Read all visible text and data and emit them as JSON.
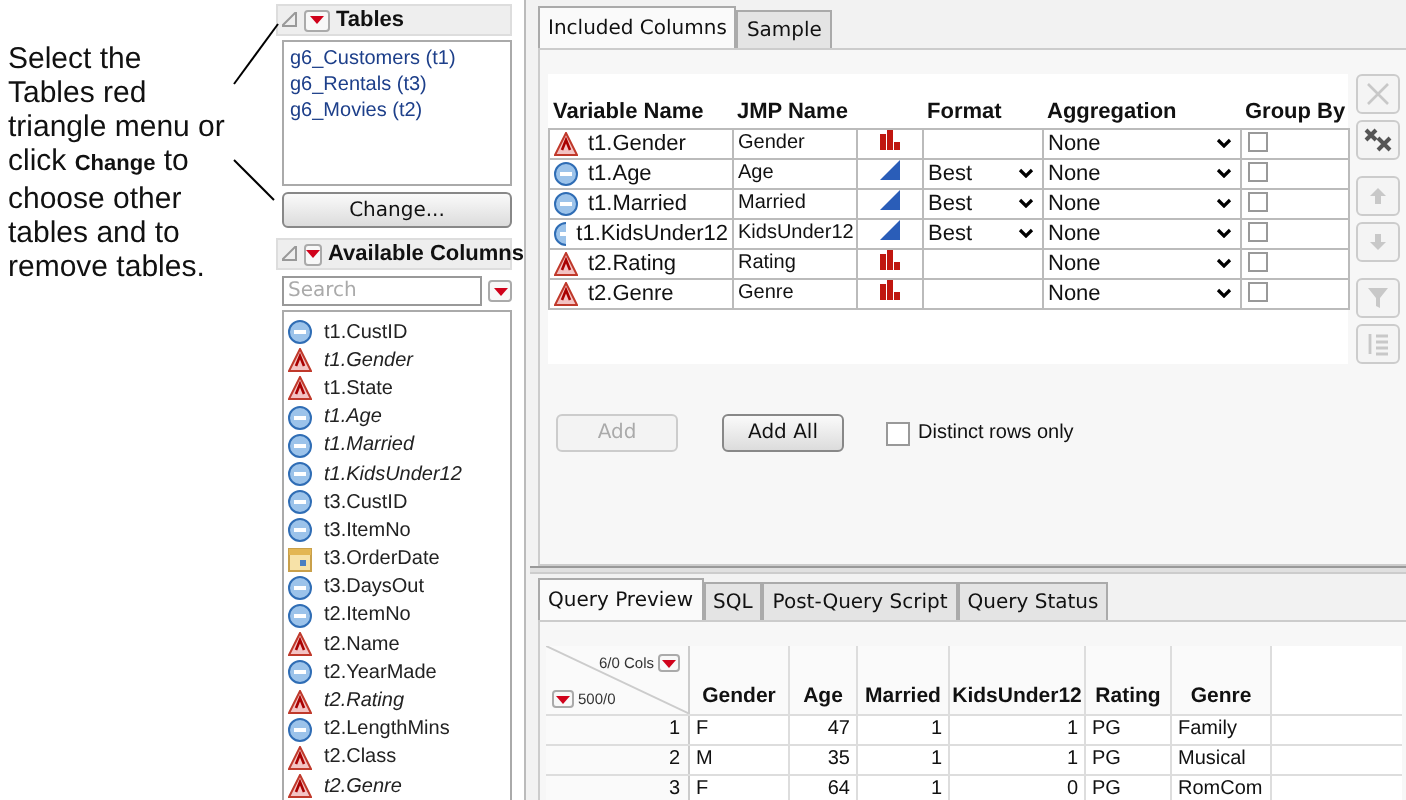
{
  "annotation": "Select the Tables red triangle menu or click **Change** to choose other tables and to remove tables.",
  "tables": {
    "title": "Tables",
    "items": [
      "g6_Customers (t1)",
      "g6_Rentals (t3)",
      "g6_Movies (t2)"
    ],
    "button": "Change..."
  },
  "available_columns": {
    "title": "Available Columns",
    "search": {
      "placeholder": "Search"
    },
    "items": [
      {
        "name": "t1.CustID",
        "kind": "numeric",
        "included": false
      },
      {
        "name": "t1.Gender",
        "kind": "character",
        "included": true
      },
      {
        "name": "t1.State",
        "kind": "character",
        "included": false
      },
      {
        "name": "t1.Age",
        "kind": "numeric",
        "included": true
      },
      {
        "name": "t1.Married",
        "kind": "numeric",
        "included": true
      },
      {
        "name": "t1.KidsUnder12",
        "kind": "numeric",
        "included": true
      },
      {
        "name": "t3.CustID",
        "kind": "numeric",
        "included": false
      },
      {
        "name": "t3.ItemNo",
        "kind": "numeric",
        "included": false
      },
      {
        "name": "t3.OrderDate",
        "kind": "date",
        "included": false
      },
      {
        "name": "t3.DaysOut",
        "kind": "numeric",
        "included": false
      },
      {
        "name": "t2.ItemNo",
        "kind": "numeric",
        "included": false
      },
      {
        "name": "t2.Name",
        "kind": "character",
        "included": false
      },
      {
        "name": "t2.YearMade",
        "kind": "numeric",
        "included": false
      },
      {
        "name": "t2.Rating",
        "kind": "character",
        "included": true
      },
      {
        "name": "t2.LengthMins",
        "kind": "numeric",
        "included": false
      },
      {
        "name": "t2.Class",
        "kind": "character",
        "included": false
      },
      {
        "name": "t2.Genre",
        "kind": "character",
        "included": true
      }
    ]
  },
  "included_tabs": [
    {
      "label": "Included Columns",
      "selected": true
    },
    {
      "label": "Sample",
      "selected": false
    }
  ],
  "included_columns": {
    "headers": {
      "variable": "Variable Name",
      "jmp_name": "JMP Name",
      "format": "Format",
      "aggregation": "Aggregation",
      "group_by": "Group By"
    },
    "rows": [
      {
        "variable": "t1.Gender",
        "kind": "character",
        "jmp_name": "Gender",
        "modeling": {
          "kind": "nominal"
        },
        "aggregation": "None",
        "group_by": false
      },
      {
        "variable": "t1.Age",
        "kind": "numeric",
        "jmp_name": "Age",
        "modeling": {
          "kind": "continuous"
        },
        "format": "Best",
        "aggregation": "None",
        "group_by": false
      },
      {
        "variable": "t1.Married",
        "kind": "numeric",
        "jmp_name": "Married",
        "modeling": {
          "kind": "continuous"
        },
        "format": "Best",
        "aggregation": "None",
        "group_by": false
      },
      {
        "variable": "t1.KidsUnder12",
        "kind": "numeric",
        "jmp_name": "KidsUnder12",
        "modeling": {
          "kind": "continuous"
        },
        "format": "Best",
        "aggregation": "None",
        "group_by": false
      },
      {
        "variable": "t2.Rating",
        "kind": "character",
        "jmp_name": "Rating",
        "modeling": {
          "kind": "nominal"
        },
        "aggregation": "None",
        "group_by": false
      },
      {
        "variable": "t2.Genre",
        "kind": "character",
        "jmp_name": "Genre",
        "modeling": {
          "kind": "nominal"
        },
        "aggregation": "None",
        "group_by": false
      }
    ]
  },
  "side_tools": [
    {
      "kind": "remove",
      "disabled": true
    },
    {
      "kind": "remove_all",
      "disabled": false
    },
    {
      "kind": "up",
      "disabled": true
    },
    {
      "kind": "down",
      "disabled": true
    },
    {
      "kind": "filter",
      "disabled": true
    },
    {
      "kind": "sort",
      "disabled": true
    }
  ],
  "actions": {
    "add": {
      "label": "Add",
      "disabled": true
    },
    "add_all": {
      "label": "Add All",
      "disabled": false
    },
    "distinct": {
      "label": "Distinct rows only",
      "checked": false
    }
  },
  "preview_tabs": [
    {
      "label": "Query Preview",
      "selected": true
    },
    {
      "label": "SQL",
      "selected": false
    },
    {
      "label": "Post-Query Script",
      "selected": false
    },
    {
      "label": "Query Status",
      "selected": false
    }
  ],
  "preview": {
    "cols_label": "6/0 Cols",
    "rows_label": "500/0",
    "columns": [
      {
        "name": "Gender",
        "kind": "character"
      },
      {
        "name": "Age",
        "kind": "numeric"
      },
      {
        "name": "Married",
        "kind": "numeric"
      },
      {
        "name": "KidsUnder12",
        "kind": "numeric"
      },
      {
        "name": "Rating",
        "kind": "character"
      },
      {
        "name": "Genre",
        "kind": "character"
      }
    ],
    "rows": [
      {
        "number": "1",
        "cells": [
          "F",
          "47",
          "1",
          "1",
          "PG",
          "Family"
        ]
      },
      {
        "number": "2",
        "cells": [
          "M",
          "35",
          "1",
          "1",
          "PG",
          "Musical"
        ]
      },
      {
        "number": "3",
        "cells": [
          "F",
          "64",
          "1",
          "0",
          "PG",
          "RomCom"
        ]
      }
    ]
  }
}
